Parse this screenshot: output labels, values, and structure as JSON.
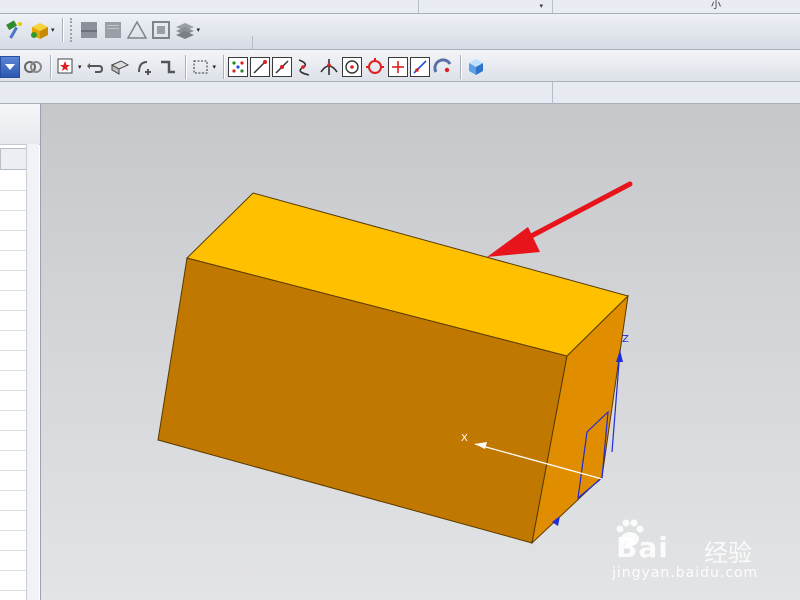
{
  "top_strip": {
    "combo_arrow": "▾",
    "right_text": "小"
  },
  "toolbar1": {
    "icons": [
      "hammer-wand-icon",
      "assembly-icon",
      "layer-icon",
      "layer-gray-icon",
      "triangle-icon",
      "frame-icon",
      "stack-icon"
    ]
  },
  "toolbar2": {
    "icons": [
      "view-dropdown-icon",
      "shape-link-icon",
      "snap-star-icon",
      "undo-arrow-icon",
      "part-icon",
      "gear-point-icon",
      "routing-icon",
      "selection-box-icon",
      "point-grid-icon",
      "endpoint-line-icon",
      "midpoint-line-icon",
      "curve-icon",
      "intersection-icon",
      "center-circle-icon",
      "quadrant-circle-icon",
      "plus-point-icon",
      "tangent-line-icon",
      "arc-center-icon",
      "cube-view-icon"
    ]
  },
  "viewport": {
    "background_top": "#c5c7ca",
    "background_bottom": "#e3e4e6",
    "block": {
      "top_color": "#ffc000",
      "front_color": "#c07800",
      "side_color": "#e08e00"
    },
    "arrow_color": "#e8141b",
    "csys": {
      "x_label": "X",
      "z_label": "Z",
      "color": "#1f2bd8"
    }
  },
  "watermark": {
    "brand": "Bai",
    "cn_text": "经验",
    "url": "jingyan.baidu.com"
  }
}
